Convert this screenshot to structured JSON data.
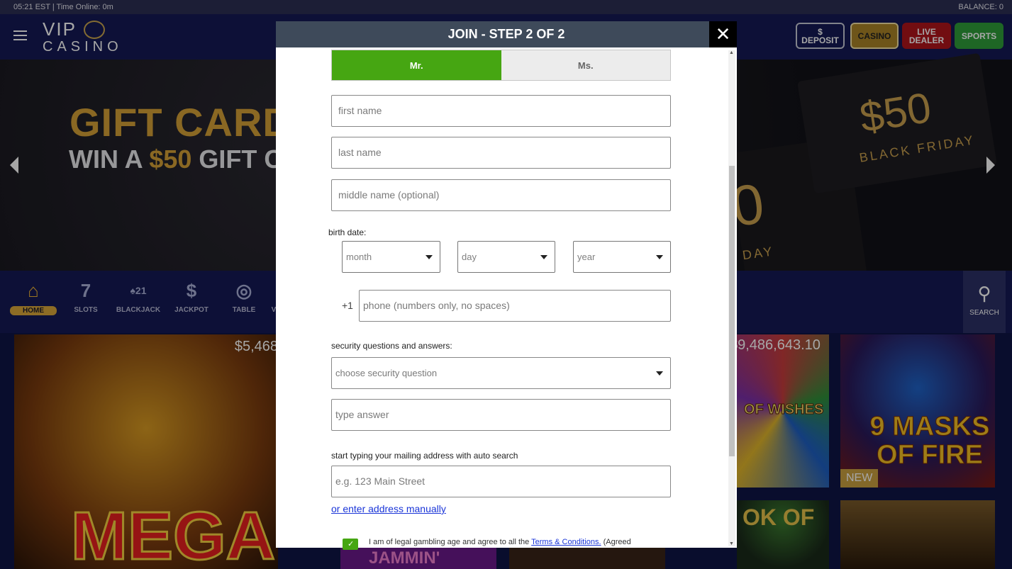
{
  "statusbar": {
    "left": "05:21 EST | Time Online: 0m",
    "right": "BALANCE: 0"
  },
  "header": {
    "logo_top": "VIP",
    "logo_bottom": "CASINO",
    "deposit_symbol": "$",
    "deposit": "DEPOSIT",
    "casino": "CASINO",
    "live_line1": "LIVE",
    "live_line2": "DEALER",
    "sports": "SPORTS"
  },
  "banner": {
    "line1": "GIFT CARD",
    "line2_prefix": "WIN A ",
    "line2_amount": "$50",
    "line2_suffix": " GIFT C",
    "card_amount": "$50",
    "card_text": "BLACK FRIDAY",
    "card_partial_amount": "0",
    "card_partial_text": "DAY"
  },
  "categories": {
    "home": "HOME",
    "slots": "SLOTS",
    "blackjack": "BLACKJACK",
    "blackjack_num": "21",
    "jackpot": "JACKPOT",
    "table": "TABLE",
    "partial": "V",
    "search": "SEARCH"
  },
  "games": {
    "mega_jackpot": "$5,468",
    "mega_name": "MEGA",
    "wishes_jackpot": "$9,486,643.10",
    "wishes_name": "OF WISHES",
    "masks_name": "9 MASKS OF FIRE",
    "masks_badge": "NEW",
    "book_name": "OK OF",
    "jammin_name": "JAMMIN'"
  },
  "modal": {
    "title": "JOIN - STEP 2 OF 2",
    "close": "✕",
    "gender_mr": "Mr.",
    "gender_ms": "Ms.",
    "first_name_placeholder": "first name",
    "last_name_placeholder": "last name",
    "middle_name_placeholder": "middle name (optional)",
    "birth_date_label": "birth date:",
    "month_placeholder": "month",
    "day_placeholder": "day",
    "year_placeholder": "year",
    "phone_prefix": "+1",
    "phone_placeholder": "phone (numbers only, no spaces)",
    "security_label": "security questions and answers:",
    "security_select": "choose security question",
    "answer_placeholder": "type answer",
    "address_label": "start typing your mailing address with auto search",
    "address_placeholder": "e.g. 123 Main Street",
    "manual_link": "or enter address manually",
    "agree_text": "I am of legal gambling age and agree to all the ",
    "terms_link": "Terms & Conditions.",
    "agree_suffix": " (Agreed"
  }
}
